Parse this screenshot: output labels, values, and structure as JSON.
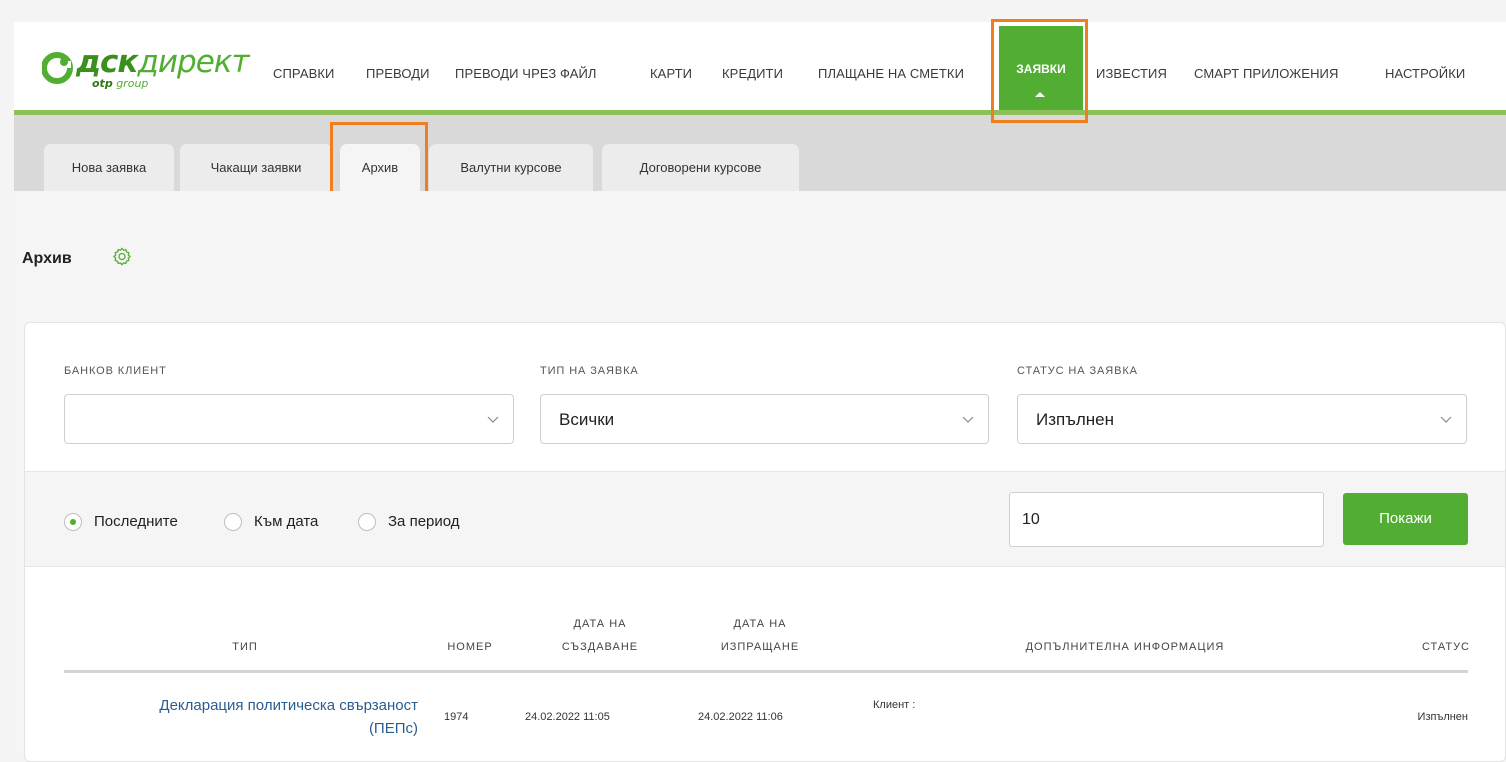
{
  "brand": {
    "name_bold": "дск",
    "name_rest": "директ",
    "sub_bold": "otp",
    "sub_rest": "group"
  },
  "nav": {
    "items": [
      "СПРАВКИ",
      "ПРЕВОДИ",
      "ПРЕВОДИ ЧРЕЗ ФАЙЛ",
      "КАРТИ",
      "КРЕДИТИ",
      "ПЛАЩАНЕ НА СМЕТКИ",
      "ЗАЯВКИ",
      "ИЗВЕСТИЯ",
      "СМАРТ ПРИЛОЖЕНИЯ",
      "НАСТРОЙКИ"
    ],
    "active": "ЗАЯВКИ"
  },
  "subtabs": {
    "items": [
      "Нова заявка",
      "Чакащи заявки",
      "Архив",
      "Валутни курсове",
      "Договорени курсове"
    ],
    "active": "Архив"
  },
  "page": {
    "title": "Архив",
    "settings_icon": "gear-icon"
  },
  "filters": {
    "client": {
      "label": "БАНКОВ КЛИЕНТ",
      "value": ""
    },
    "type": {
      "label": "ТИП НА ЗАЯВКА",
      "value": "Всички"
    },
    "status": {
      "label": "СТАТУС НА ЗАЯВКА",
      "value": "Изпълнен"
    },
    "mode": {
      "options": [
        "Последните",
        "Към дата",
        "За период"
      ],
      "selected": "Последните"
    },
    "count": "10",
    "show_button": "Покажи"
  },
  "table": {
    "headers": {
      "type": "ТИП",
      "number": "НОМЕР",
      "created_1": "ДАТА НА",
      "created_2": "СЪЗДАВАНЕ",
      "sent_1": "ДАТА НА",
      "sent_2": "ИЗПРАЩАНЕ",
      "info": "ДОПЪЛНИТЕЛНА ИНФОРМАЦИЯ",
      "status": "СТАТУС"
    },
    "rows": [
      {
        "type_1": "Декларация политическа свързаност",
        "type_2": "(ПЕПс)",
        "number": "1974",
        "created": "24.02.2022 11:05",
        "sent": "24.02.2022 11:06",
        "info": "Клиент :",
        "status": "Изпълнен"
      }
    ]
  },
  "colors": {
    "brand_green": "#52ae32",
    "highlight_orange": "#f07d1e",
    "link_blue": "#2b5d8f"
  }
}
